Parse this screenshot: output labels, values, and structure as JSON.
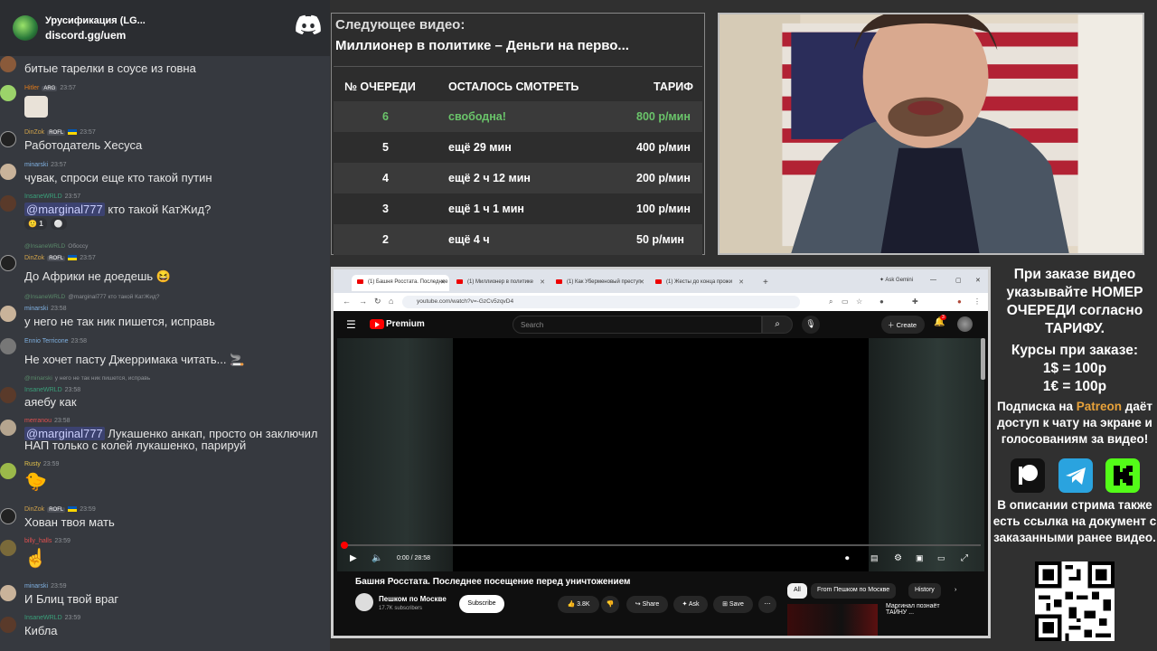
{
  "discord": {
    "server_name": "Урусификация (LG...",
    "server_link": "discord.gg/uem",
    "messages": [
      {
        "nick": "",
        "time": "",
        "text": "битые тарелки в соусе из говна"
      },
      {
        "nick": "Hitler",
        "badge": "ARG",
        "time": "23:57",
        "text": ""
      },
      {
        "nick": "DinZok",
        "badge": "ROFL",
        "time": "23:57",
        "text": "Работодатель Хесуса"
      },
      {
        "nick": "minarski",
        "time": "23:57",
        "text": "чувак, спроси еще кто такой путин"
      },
      {
        "nick": "InsaneWRLD",
        "time": "23:57",
        "mention": "@marginal777",
        "text": " кто такой КатЖид?",
        "reactions": [
          "1",
          "0"
        ]
      },
      {
        "reply_nick": "@InsaneWRLD",
        "reply_text": "Обоссу",
        "nick": "DinZok",
        "badge": "ROFL",
        "time": "23:57",
        "text": "До Африки не доедешь"
      },
      {
        "reply_nick": "@InsaneWRLD",
        "reply_text": "@marginal777 кто такой КатЖид?",
        "nick": "minarski",
        "time": "23:58",
        "text": "у него не так ник пишется,  исправь"
      },
      {
        "nick": "Ennio Terricone",
        "time": "23:58",
        "text": "Не хочет пасту Джерримака читать..."
      },
      {
        "reply_nick": "@minarski",
        "reply_text": "у него не так ник пишется,  исправь",
        "nick": "InsaneWRLD",
        "time": "23:58",
        "text": "аяебу как"
      },
      {
        "nick": "merranou",
        "time": "23:58",
        "mention": "@marginal777",
        "text": " Лукашенко анкап, просто он заключил",
        "text2": "НАП только с колей лукашенко, парируй"
      },
      {
        "nick": "Rusty",
        "time": "23:59",
        "text": ""
      },
      {
        "nick": "DinZok",
        "badge": "ROFL",
        "time": "23:59",
        "text": "Хован твоя мать"
      },
      {
        "nick": "billy_halls",
        "time": "23:59",
        "text": ""
      },
      {
        "nick": "minarski",
        "time": "23:59",
        "text": "И Блиц твой враг"
      },
      {
        "nick": "InsaneWRLD",
        "time": "23:59",
        "text": "Кибла"
      }
    ]
  },
  "queue": {
    "subtitle": "Следующее видео:",
    "title": "Миллионер в политике – Деньги на перво...",
    "headers": [
      "№ ОЧЕРЕДИ",
      "ОСТАЛОСЬ СМОТРЕТЬ",
      "ТАРИФ"
    ],
    "rows": [
      {
        "num": "6",
        "left": "свободна!",
        "tariff": "800 р/мин"
      },
      {
        "num": "5",
        "left": "ещё 29 мин",
        "tariff": "400 р/мин"
      },
      {
        "num": "4",
        "left": "ещё 2 ч 12 мин",
        "tariff": "200 р/мин"
      },
      {
        "num": "3",
        "left": "ещё 1 ч 1 мин",
        "tariff": "100 р/мин"
      },
      {
        "num": "2",
        "left": "ещё 4 ч",
        "tariff": "50 р/мин"
      }
    ]
  },
  "browser": {
    "tabs": [
      "(1) Башня Росстата. Последнее",
      "(1) Миллионер в политике",
      "(1) Как Уберменовый преступ",
      "(1) Жесты до конца прожи"
    ],
    "ask_gemini": "Ask Gemini",
    "url": "youtube.com/watch?v=-GzCv5zqvD4",
    "brand": "Premium",
    "search_placeholder": "Search",
    "create_label": "Create",
    "bell_count": "3",
    "timecode": "0:00 / 28:58",
    "video_title": "Башня Росстата. Последнее посещение перед уничтожением",
    "channel_name": "Пешком по Москве",
    "channel_subs": "17.7K subscribers",
    "subscribe": "Subscribe",
    "likes": "3.8K",
    "share": "Share",
    "ask": "Ask",
    "save": "Save",
    "chips": [
      "All",
      "From Пешком по Москве",
      "History"
    ],
    "rec_title": "Маргинал познаёт ТАЙНУ ..."
  },
  "info": {
    "p1": "При заказе видео указывайте НОМЕР ОЧЕРЕДИ согласно ТАРИФУ.",
    "p2": "Курсы при заказе:",
    "p3": "1$ = 100р",
    "p4": "1€ = 100р",
    "p5a": "Подписка на ",
    "p5b": "Patreon",
    "p5c": " даёт доступ к чату на экране и голосованиям за видео!",
    "p6": "В описании стрима также есть ссылка на документ с заказанными ранее видео."
  },
  "colors": {
    "accent_green": "#6ac46a",
    "patreon": "#e8a23a",
    "youtube_red": "#ff0000",
    "discord_bg": "#36393f"
  }
}
